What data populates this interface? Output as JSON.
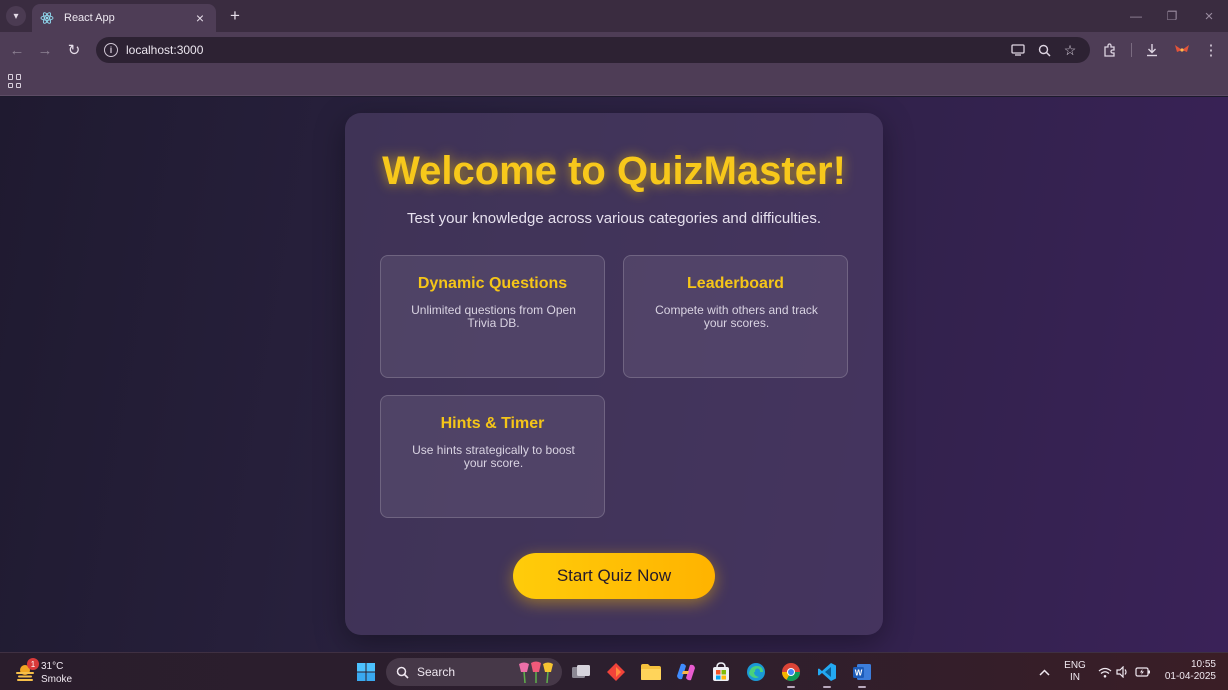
{
  "browser": {
    "tab_title": "React App",
    "url": "localhost:3000"
  },
  "page": {
    "title": "Welcome to QuizMaster!",
    "subtitle": "Test your knowledge across various categories and difficulties.",
    "features": [
      {
        "title": "Dynamic Questions",
        "description": "Unlimited questions from Open Trivia DB."
      },
      {
        "title": "Leaderboard",
        "description": "Compete with others and track your scores."
      },
      {
        "title": "Hints & Timer",
        "description": "Use hints strategically to boost your score."
      }
    ],
    "start_button": "Start Quiz Now",
    "colors": {
      "accent": "#f7c81b",
      "card": "#3f3358",
      "background": "#241d36"
    }
  },
  "taskbar": {
    "weather_temp": "31°C",
    "weather_condition": "Smoke",
    "weather_badge": "1",
    "search_placeholder": "Search",
    "language": "ENG",
    "region": "IN",
    "time": "10:55",
    "date": "01-04-2025",
    "pinned_apps": [
      "file-explorer-icon",
      "app-icon",
      "folder-icon",
      "copilot-icon",
      "store-icon",
      "edge-icon",
      "chrome-icon",
      "vscode-icon",
      "word-icon"
    ]
  }
}
